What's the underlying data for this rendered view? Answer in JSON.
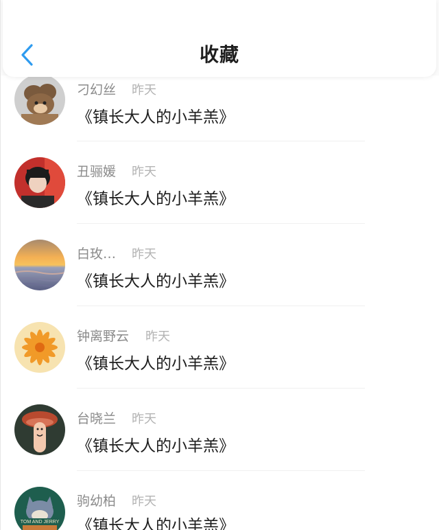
{
  "header": {
    "title": "收藏",
    "back_icon": "chevron-left-icon",
    "accent_color": "#2e9bef"
  },
  "items": [
    {
      "user": "刁幻丝",
      "time": "昨天",
      "book": "《镇长大人的小羊羔》",
      "avatar": "cartoon-mouse"
    },
    {
      "user": "丑骊媛",
      "time": "昨天",
      "book": "《镇长大人的小羊羔》",
      "avatar": "portrait-red"
    },
    {
      "user": "白玫…",
      "time": "昨天",
      "book": "《镇长大人的小羊羔》",
      "avatar": "sunset-beach"
    },
    {
      "user": "钟离野云",
      "time": "昨天",
      "book": "《镇长大人的小羊羔》",
      "avatar": "orange-flower"
    },
    {
      "user": "台晓兰",
      "time": "昨天",
      "book": "《镇长大人的小羊羔》",
      "avatar": "finger-mushroom"
    },
    {
      "user": "驹幼柏",
      "time": "昨天",
      "book": "《镇长大人的小羊羔》",
      "avatar": "tom-and-jerry"
    }
  ]
}
